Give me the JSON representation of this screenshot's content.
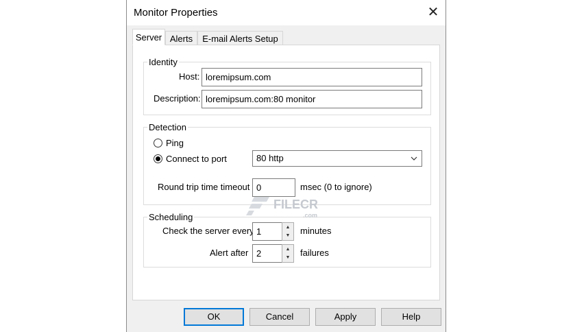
{
  "window": {
    "title": "Monitor Properties",
    "close_glyph": "✕"
  },
  "tabs": [
    {
      "label": "Server",
      "active": true
    },
    {
      "label": "Alerts",
      "active": false
    },
    {
      "label": "E-mail Alerts Setup",
      "active": false
    }
  ],
  "identity": {
    "legend": "Identity",
    "host_label": "Host:",
    "host_value": "loremipsum.com",
    "description_label": "Description:",
    "description_value": "loremipsum.com:80 monitor"
  },
  "detection": {
    "legend": "Detection",
    "ping_label": "Ping",
    "ping_selected": false,
    "connect_label": "Connect to port",
    "connect_selected": true,
    "port_value": "80 http",
    "timeout_label": "Round trip time timeout",
    "timeout_value": "0",
    "timeout_unit": "msec (0 to ignore)"
  },
  "scheduling": {
    "legend": "Scheduling",
    "check_label": "Check the server every",
    "check_value": "1",
    "check_unit": "minutes",
    "alert_label": "Alert after",
    "alert_value": "2",
    "alert_unit": "failures"
  },
  "buttons": {
    "ok": "OK",
    "cancel": "Cancel",
    "apply": "Apply",
    "help": "Help"
  },
  "watermark": {
    "brand": "FILECR",
    "suffix": ".com"
  },
  "icons": {
    "close": "close-icon",
    "dropdown": "chevron-down-icon",
    "spin_up": "spin-up-icon",
    "spin_down": "spin-down-icon"
  },
  "colors": {
    "dialog_bg": "#f0f0f0",
    "default_button_border": "#0078d7"
  }
}
